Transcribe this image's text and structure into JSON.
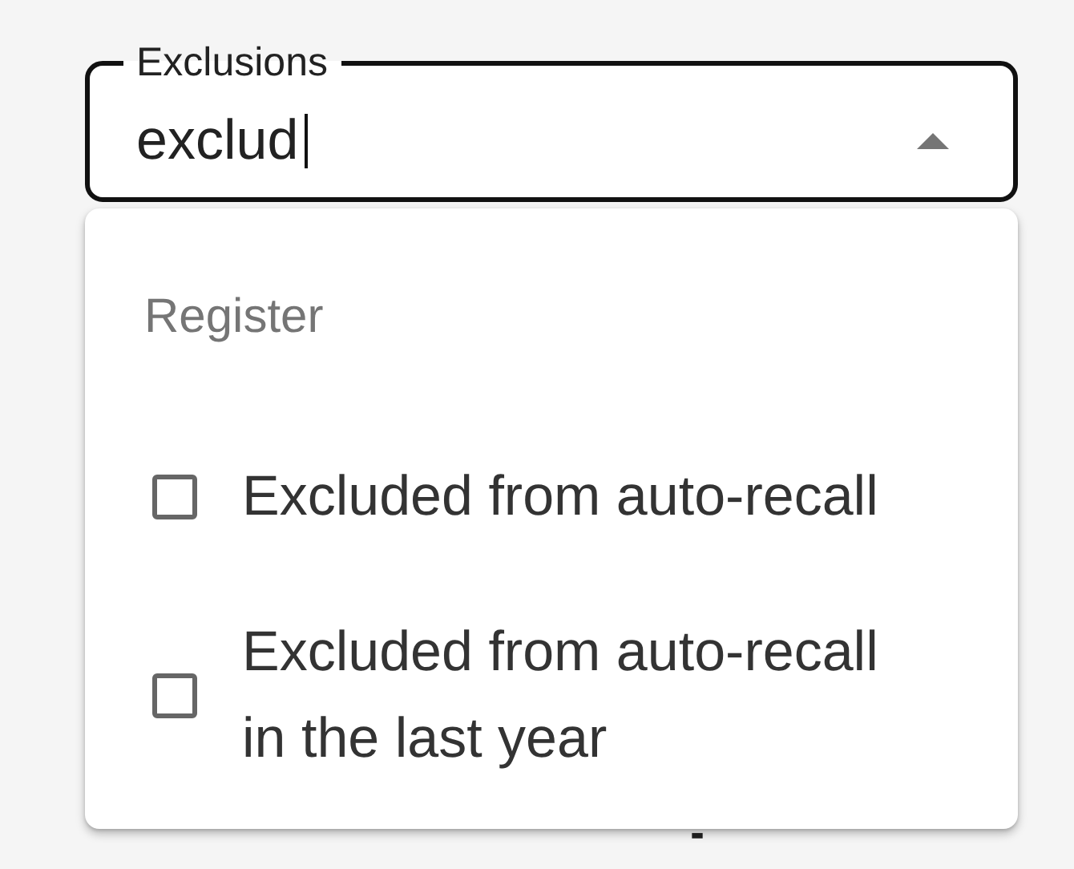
{
  "field": {
    "label": "Exclusions",
    "value": "exclud",
    "expanded": true
  },
  "dropdown": {
    "group_header": "Register",
    "options": [
      {
        "label": "Excluded from auto-recall",
        "checked": false
      },
      {
        "label": "Excluded from auto-recall in the last year",
        "checked": false
      }
    ]
  }
}
